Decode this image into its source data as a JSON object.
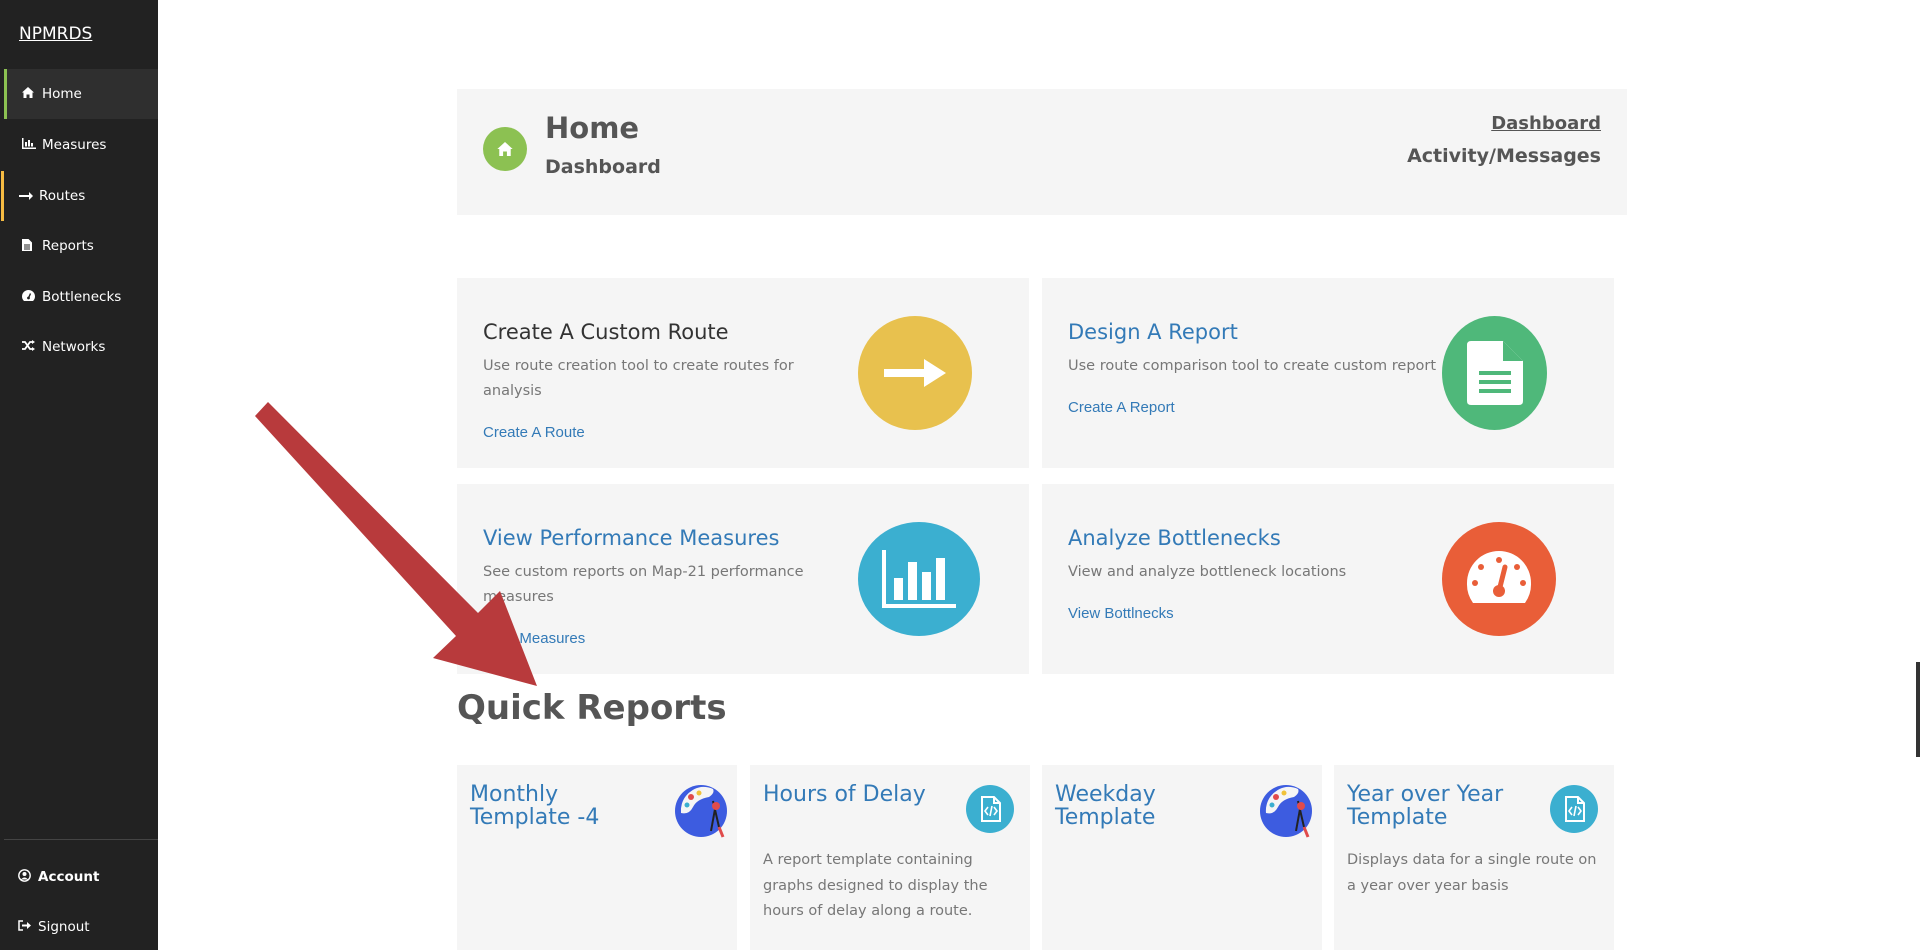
{
  "sidebar": {
    "brand": "NPMRDS",
    "items": [
      {
        "label": "Home",
        "icon": "home-icon"
      },
      {
        "label": "Measures",
        "icon": "bar-chart-icon"
      },
      {
        "label": "Routes",
        "icon": "arrow-right-icon"
      },
      {
        "label": "Reports",
        "icon": "file-icon"
      },
      {
        "label": "Bottlenecks",
        "icon": "dashboard-icon"
      },
      {
        "label": "Networks",
        "icon": "random-icon"
      }
    ],
    "bottom": [
      {
        "label": "Account",
        "icon": "user-circle-icon"
      },
      {
        "label": "Signout",
        "icon": "sign-out-icon"
      }
    ],
    "colors": {
      "background": "#222222",
      "active_accent": "#8cc152",
      "routes_accent": "#f6bb42"
    }
  },
  "header": {
    "title": "Home",
    "subtitle": "Dashboard",
    "link": "Dashboard",
    "messages": "Activity/Messages",
    "icon": "home-icon",
    "icon_color": "#8cc152"
  },
  "actions": [
    {
      "title": "Create A Custom Route",
      "desc": "Use route creation tool to create routes for analysis",
      "link": "Create A Route",
      "icon": "arrow-right-icon",
      "color": "#e8c14e"
    },
    {
      "title": "Design A Report",
      "desc": "Use route comparison tool to create custom report",
      "link": "Create A Report",
      "icon": "file-text-icon",
      "color": "#4fb87a"
    },
    {
      "title": "View Performance Measures",
      "desc": "See custom reports on Map-21 performance measures",
      "link": "View Measures",
      "icon": "bar-chart-icon",
      "color": "#3bafd0"
    },
    {
      "title": "Analyze Bottlenecks",
      "desc": "View and analyze bottleneck locations",
      "link": "View Bottlnecks",
      "icon": "gauge-icon",
      "color": "#e95e38"
    }
  ],
  "quick_reports": {
    "heading": "Quick Reports",
    "items": [
      {
        "title": "Monthly Template -4",
        "desc": "",
        "icon": "palette-icon"
      },
      {
        "title": "Hours of Delay",
        "desc": "A report template containing graphs designed to display the hours of delay along a route.",
        "icon": "code-file-icon"
      },
      {
        "title": "Weekday Template",
        "desc": "",
        "icon": "palette-icon"
      },
      {
        "title": "Year over Year Template",
        "desc": "Displays data for a single route on a year over year basis",
        "icon": "code-file-icon"
      }
    ]
  }
}
